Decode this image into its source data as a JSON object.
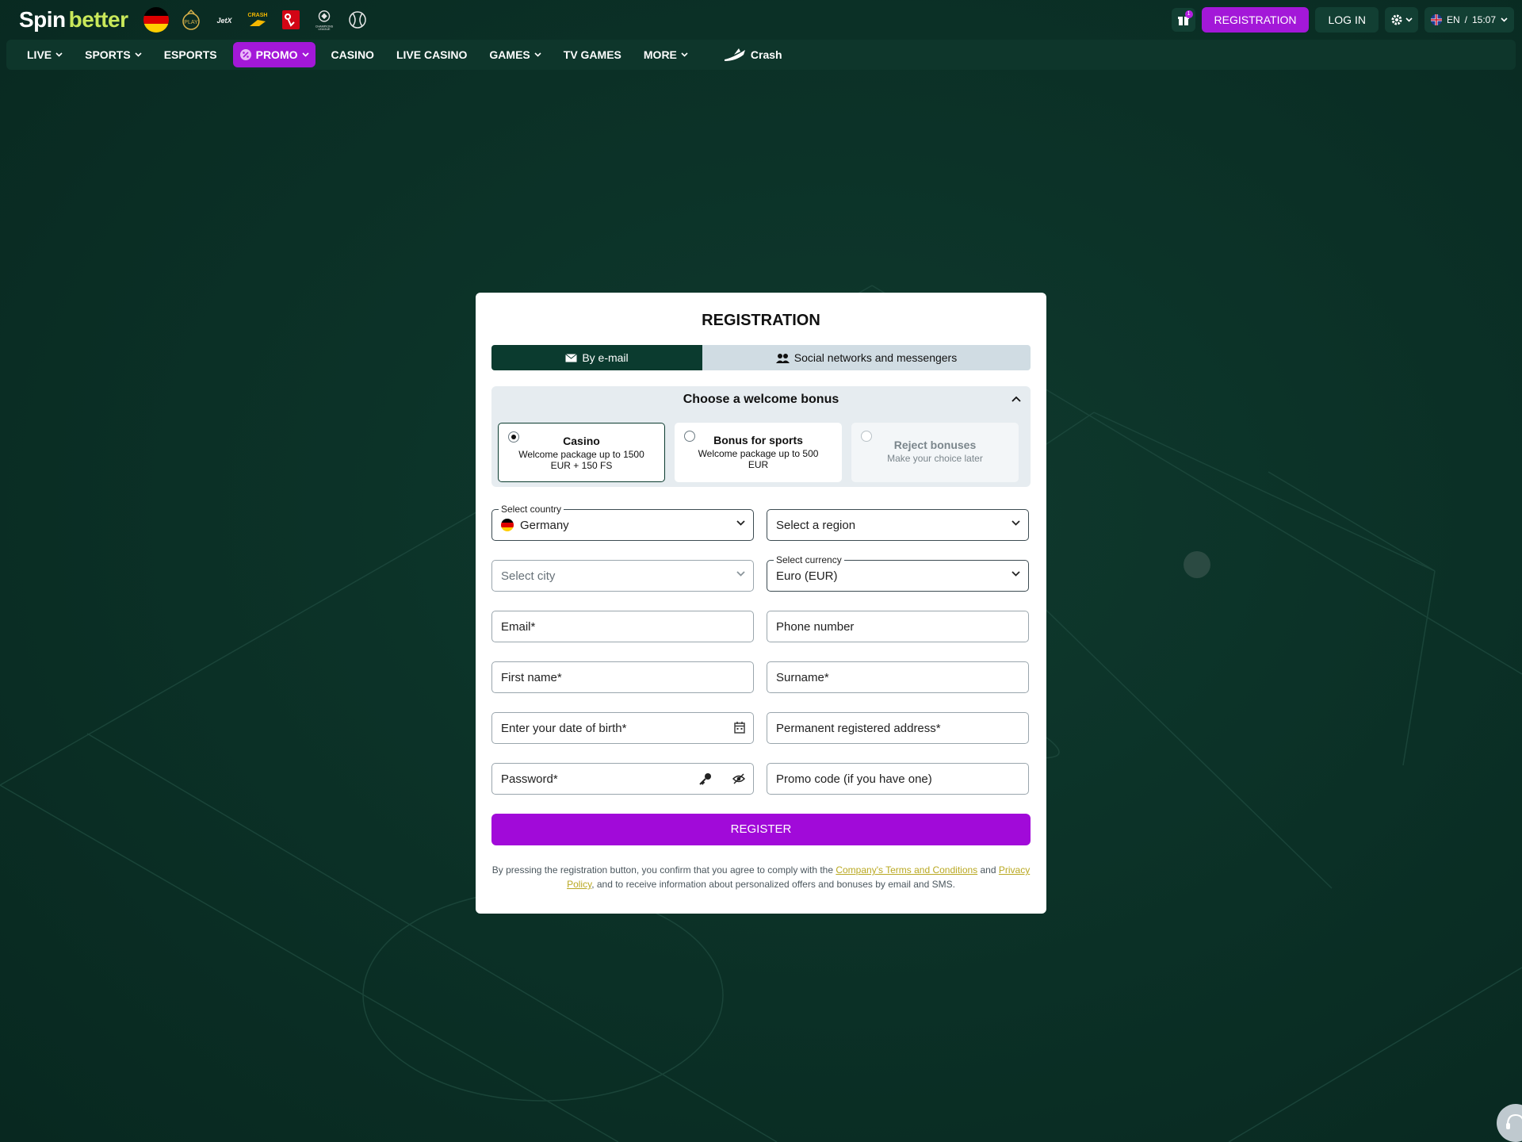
{
  "brand": {
    "logo_part1": "Spin",
    "logo_part2": "better"
  },
  "top_icons": [
    "germany-flag-icon",
    "play-icon",
    "jetx-icon",
    "crash-icon",
    "bundesliga-icon",
    "champions-league-icon",
    "tennis-icon"
  ],
  "header": {
    "gift_count": "1",
    "registration_label": "REGISTRATION",
    "login_label": "LOG IN",
    "language": "EN",
    "time": "15:07"
  },
  "nav": {
    "items": [
      {
        "label": "LIVE",
        "dropdown": true
      },
      {
        "label": "SPORTS",
        "dropdown": true
      },
      {
        "label": "ESPORTS",
        "dropdown": false
      },
      {
        "label": "PROMO",
        "dropdown": true
      },
      {
        "label": "CASINO",
        "dropdown": false
      },
      {
        "label": "LIVE CASINO",
        "dropdown": false
      },
      {
        "label": "GAMES",
        "dropdown": true
      },
      {
        "label": "TV GAMES",
        "dropdown": false
      },
      {
        "label": "MORE",
        "dropdown": true
      },
      {
        "label": "Crash",
        "dropdown": false
      }
    ]
  },
  "modal": {
    "title": "REGISTRATION",
    "tabs": {
      "email": "By e-mail",
      "social": "Social networks and messengers"
    },
    "bonus": {
      "heading": "Choose a welcome bonus",
      "cards": [
        {
          "title": "Casino",
          "subtitle": "Welcome package up to 1500 EUR + 150 FS",
          "selected": true
        },
        {
          "title": "Bonus for sports",
          "subtitle": "Welcome package up to 500 EUR",
          "selected": false
        },
        {
          "title": "Reject bonuses",
          "subtitle": "Make your choice later",
          "selected": false
        }
      ]
    },
    "form": {
      "country_legend": "Select country",
      "country_value": "Germany",
      "region_placeholder": "Select a region",
      "city_placeholder": "Select city",
      "currency_legend": "Select currency",
      "currency_value": "Euro (EUR)",
      "email_placeholder": "Email*",
      "phone_placeholder": "Phone number",
      "first_name_placeholder": "First name*",
      "surname_placeholder": "Surname*",
      "dob_placeholder": "Enter your date of birth*",
      "address_placeholder": "Permanent registered address*",
      "password_placeholder": "Password*",
      "promo_placeholder": "Promo code (if you have one)"
    },
    "register_label": "REGISTER",
    "terms": {
      "prefix": "By pressing the registration button, you confirm that you agree to comply with the ",
      "terms_link": "Company's Terms and Conditions",
      "and": " and ",
      "privacy_link": "Privacy Policy",
      "suffix": ", and to receive information about personalized offers and bonuses by email and SMS."
    }
  },
  "colors": {
    "background": "#0b3026",
    "accent": "#a318d8",
    "logo_green": "#c9e85a",
    "tab_active": "#0b3b2f",
    "link": "#b9a821"
  }
}
